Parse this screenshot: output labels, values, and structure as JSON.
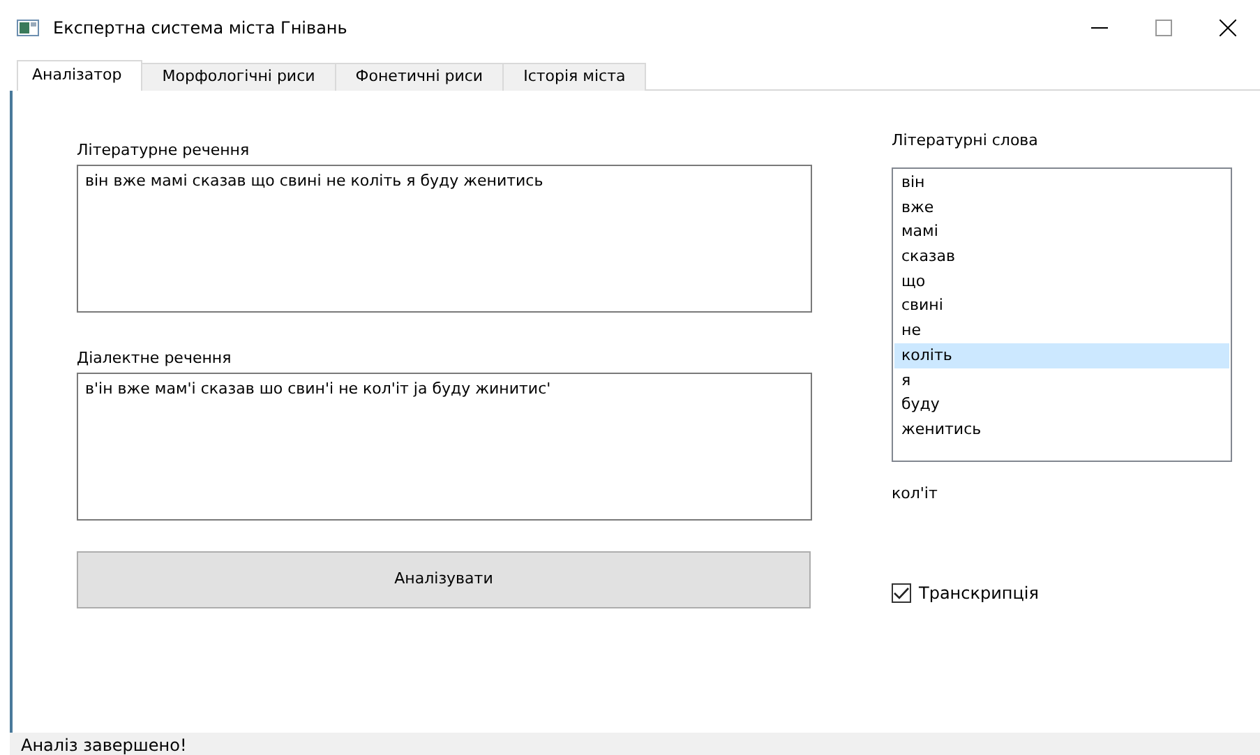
{
  "window": {
    "title": "Експертна система міста Гнівань"
  },
  "tabs": [
    {
      "label": "Аналізатор",
      "selected": true
    },
    {
      "label": "Морфологічні риси",
      "selected": false
    },
    {
      "label": "Фонетичні риси",
      "selected": false
    },
    {
      "label": "Історія міста",
      "selected": false
    }
  ],
  "literary_sentence": {
    "label": "Літературне речення",
    "value": "він вже мамі сказав що свині не коліть я буду женитись"
  },
  "dialect_sentence": {
    "label": "Діалектне речення",
    "value": "в'ін вже мам'і сказав шо свин'і не кол'іт ја буду жинитис'"
  },
  "analyze_button": "Аналізувати",
  "literary_words": {
    "label": "Літературні слова",
    "items": [
      {
        "text": "він",
        "selected": false
      },
      {
        "text": "вже",
        "selected": false
      },
      {
        "text": "мамі",
        "selected": false
      },
      {
        "text": "сказав",
        "selected": false
      },
      {
        "text": "що",
        "selected": false
      },
      {
        "text": "свині",
        "selected": false
      },
      {
        "text": "не",
        "selected": false
      },
      {
        "text": "коліть",
        "selected": true
      },
      {
        "text": "я",
        "selected": false
      },
      {
        "text": "буду",
        "selected": false
      },
      {
        "text": "женитись",
        "selected": false
      }
    ]
  },
  "dialect_word": "кол'іт",
  "transcription": {
    "label": "Транскрипція",
    "checked": true
  },
  "status_bar": "Аналіз завершено!"
}
